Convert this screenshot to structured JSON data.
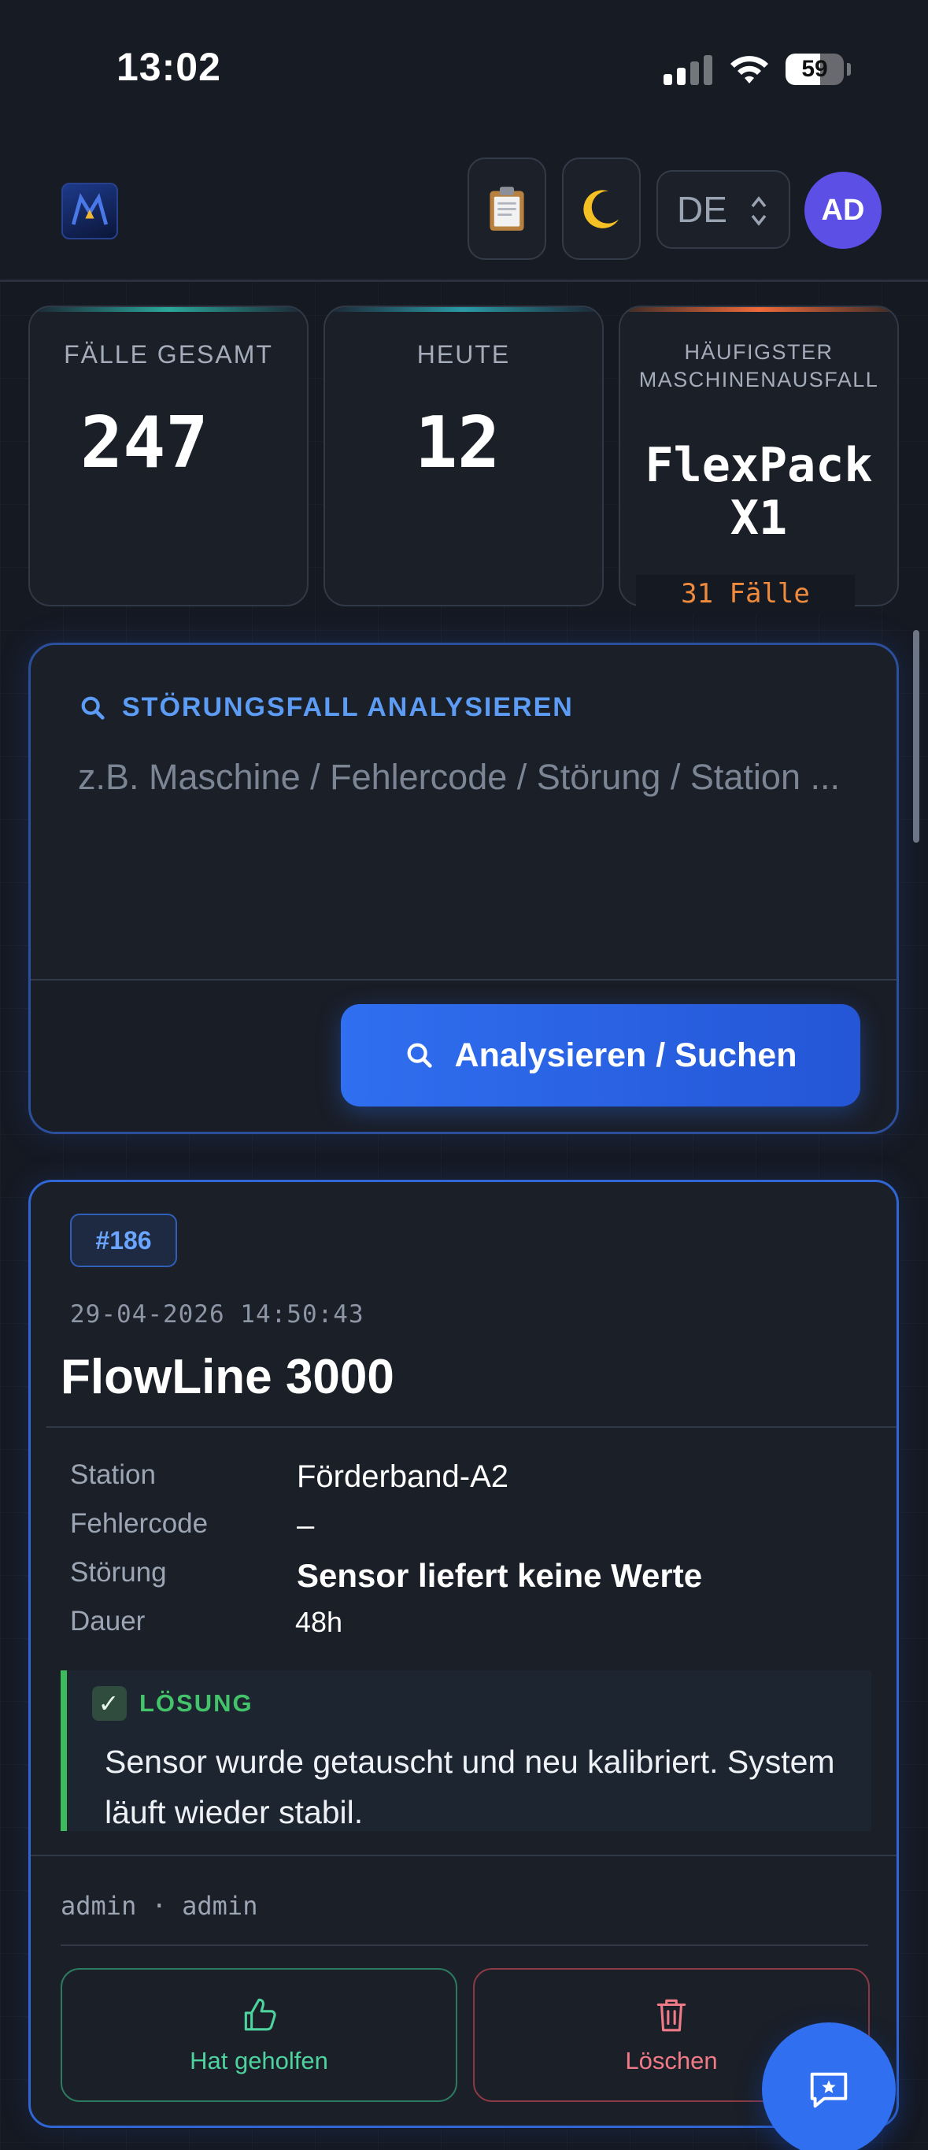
{
  "status_bar": {
    "time": "13:02",
    "battery_level": "59",
    "battery_fraction": 0.59
  },
  "header": {
    "logo_icon": "app-logo-icon",
    "clipboard_icon": "clipboard-icon",
    "theme_icon": "moon-icon",
    "language": "DE",
    "avatar_initials": "AD"
  },
  "stats": {
    "total_label": "FÄLLE GESAMT",
    "total_value": "247",
    "today_label": "HEUTE",
    "today_value": "12",
    "top_label_line1": "HÄUFIGSTER",
    "top_label_line2": "MASCHINENAUSFALL",
    "top_machine_line1": "FlexPack",
    "top_machine_line2": "X1",
    "top_count": "31 Fälle"
  },
  "colors": {
    "accent_blue": "#2f6ff0",
    "card_bar_teal": "#2aa79b",
    "card_bar_orange": "#f06a3a",
    "success_green": "#3cba5c",
    "danger_red": "#f07a86"
  },
  "search": {
    "title": "STÖRUNGSFALL ANALYSIEREN",
    "placeholder": "z.B. Maschine / Fehlercode / Störung / Station ...",
    "button_label": "Analysieren / Suchen"
  },
  "case": {
    "id": "#186",
    "date": "29-04-2026 14:50:43",
    "machine": "FlowLine 3000",
    "fields": [
      {
        "key": "Station",
        "value": "Förderband-A2"
      },
      {
        "key": "Fehlercode",
        "value": "–"
      },
      {
        "key": "Störung",
        "value": "Sensor liefert keine Werte"
      },
      {
        "key": "Dauer",
        "value": "48h"
      }
    ],
    "solution_label": "LÖSUNG",
    "solution_text": "Sensor wurde getauscht und neu kalibriert. System läuft wieder stabil.",
    "author": "admin · admin",
    "helped_label": "Hat geholfen",
    "delete_label": "Löschen"
  }
}
